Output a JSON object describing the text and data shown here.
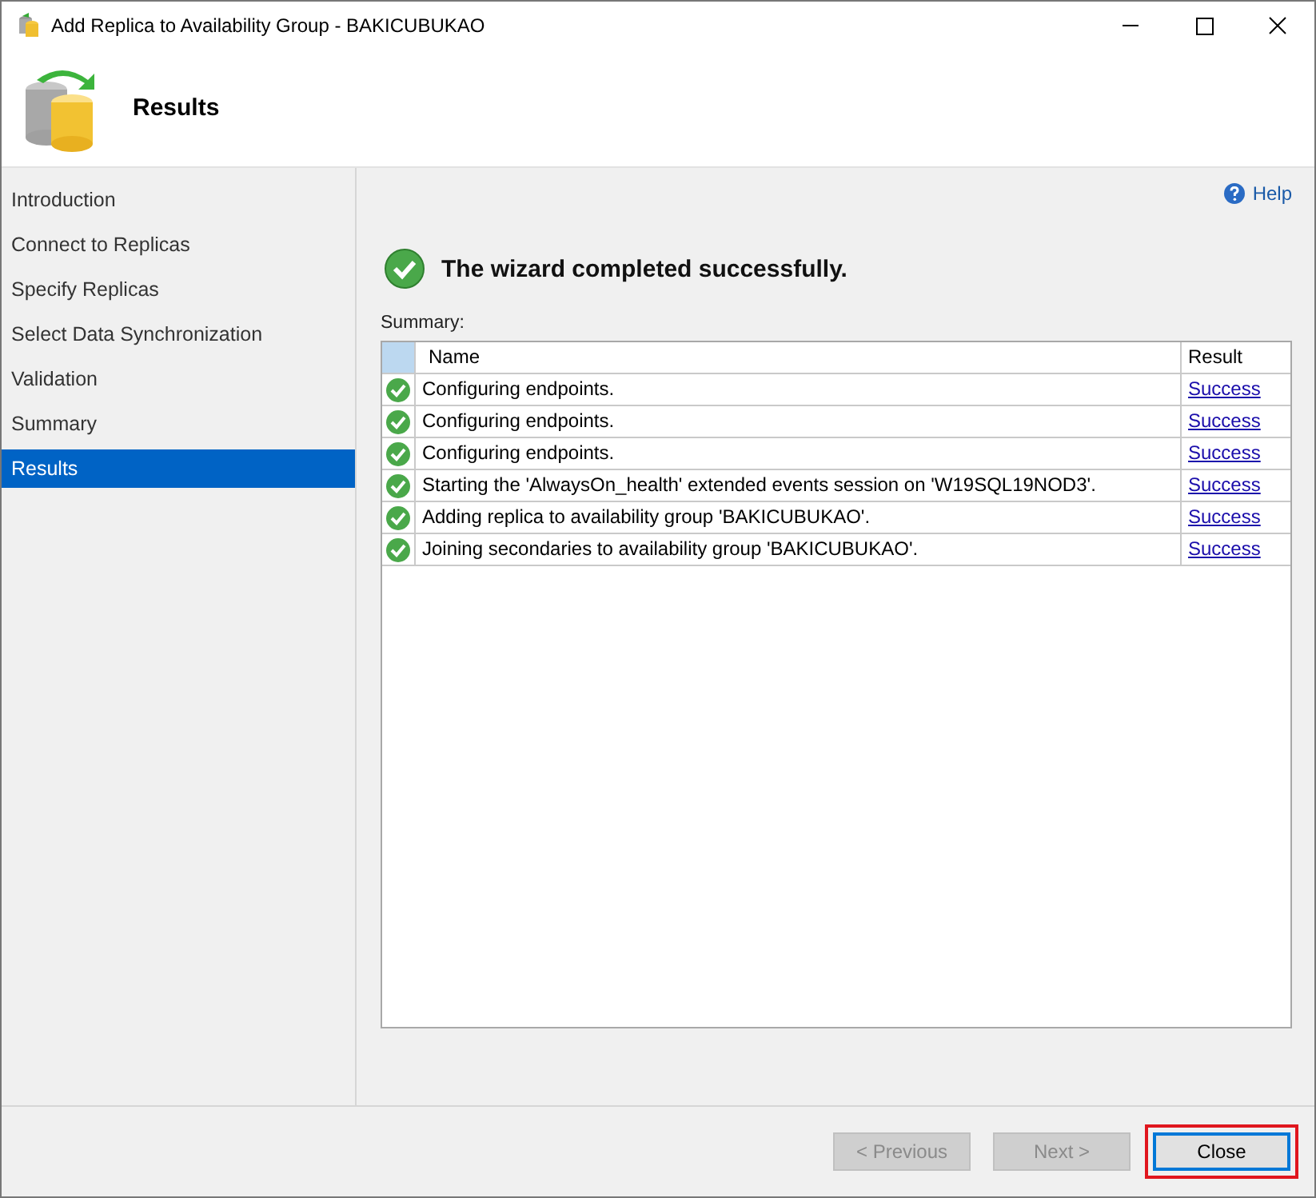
{
  "window": {
    "title": "Add Replica to Availability Group - BAKICUBUKAO"
  },
  "header": {
    "title": "Results"
  },
  "sidebar": {
    "items": [
      {
        "label": "Introduction",
        "selected": false
      },
      {
        "label": "Connect to Replicas",
        "selected": false
      },
      {
        "label": "Specify Replicas",
        "selected": false
      },
      {
        "label": "Select Data Synchronization",
        "selected": false
      },
      {
        "label": "Validation",
        "selected": false
      },
      {
        "label": "Summary",
        "selected": false
      },
      {
        "label": "Results",
        "selected": true
      }
    ]
  },
  "help_link": "Help",
  "status_message": "The wizard completed successfully.",
  "summary_label": "Summary:",
  "table": {
    "columns": [
      "Name",
      "Result"
    ],
    "rows": [
      {
        "name": "Configuring endpoints.",
        "result": "Success"
      },
      {
        "name": "Configuring endpoints.",
        "result": "Success"
      },
      {
        "name": "Configuring endpoints.",
        "result": "Success"
      },
      {
        "name": "Starting the 'AlwaysOn_health' extended events session on 'W19SQL19NOD3'.",
        "result": "Success"
      },
      {
        "name": "Adding replica to availability group 'BAKICUBUKAO'.",
        "result": "Success"
      },
      {
        "name": "Joining secondaries to availability group 'BAKICUBUKAO'.",
        "result": "Success"
      }
    ]
  },
  "buttons": [
    {
      "label": "< Previous",
      "disabled": true,
      "focused": false,
      "highlighted": false
    },
    {
      "label": "Next >",
      "disabled": true,
      "focused": false,
      "highlighted": false
    },
    {
      "label": "Close",
      "disabled": false,
      "focused": true,
      "highlighted": true
    }
  ]
}
